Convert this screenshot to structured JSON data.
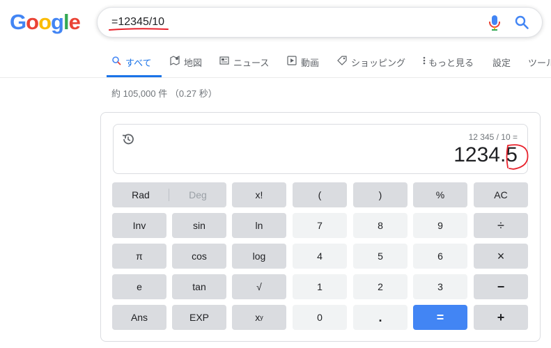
{
  "logo": {
    "letters": [
      "G",
      "o",
      "o",
      "g",
      "l",
      "e"
    ],
    "colors": [
      "#4285f4",
      "#ea4335",
      "#fbbc05",
      "#4285f4",
      "#34a853",
      "#ea4335"
    ]
  },
  "search": {
    "value": "=12345/10"
  },
  "tabs": [
    {
      "label": "すべて",
      "icon": "search-icon",
      "active": true
    },
    {
      "label": "地図",
      "icon": "map-icon"
    },
    {
      "label": "ニュース",
      "icon": "news-icon"
    },
    {
      "label": "動画",
      "icon": "play-icon"
    },
    {
      "label": "ショッピング",
      "icon": "tag-icon"
    },
    {
      "label": "もっと見る",
      "icon": "more-vert-icon"
    },
    {
      "label": "設定"
    },
    {
      "label": "ツール"
    }
  ],
  "stats": "約 105,000 件 （0.27 秒）",
  "calculator": {
    "expression": "12 345 / 10 =",
    "result": "1234.5",
    "rad_label": "Rad",
    "deg_label": "Deg",
    "buttons": {
      "fact": "x!",
      "lparen": "(",
      "rparen": ")",
      "percent": "%",
      "ac": "AC",
      "inv": "Inv",
      "sin": "sin",
      "ln": "ln",
      "seven": "7",
      "eight": "8",
      "nine": "9",
      "divide": "÷",
      "pi": "π",
      "cos": "cos",
      "log": "log",
      "four": "4",
      "five": "5",
      "six": "6",
      "multiply": "×",
      "e": "e",
      "tan": "tan",
      "sqrt": "√",
      "one": "1",
      "two": "2",
      "three": "3",
      "minus": "−",
      "ans": "Ans",
      "exp": "EXP",
      "pow_base": "x",
      "pow_exp": "y",
      "zero": "0",
      "dot": ".",
      "equals": "=",
      "plus": "+"
    }
  },
  "colors": {
    "accent": "#1a73e8",
    "equals_button": "#4285f4",
    "fn_button": "#dadce0",
    "num_button": "#f1f3f4",
    "annotation": "#e8202a"
  }
}
